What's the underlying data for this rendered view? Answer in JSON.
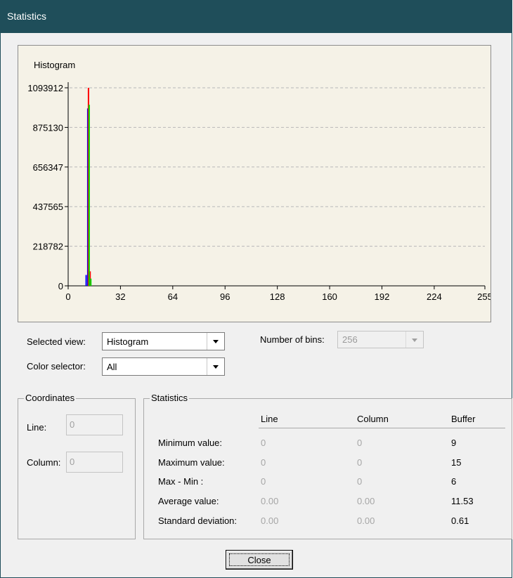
{
  "window": {
    "title": "Statistics"
  },
  "chart_data": {
    "type": "bar",
    "title": "Histogram",
    "yticks": [
      "1093912",
      "875130",
      "656347",
      "437565",
      "218782",
      "0"
    ],
    "ytick_values": [
      1093912,
      875130,
      656347,
      437565,
      218782,
      0
    ],
    "xticks": [
      "0",
      "32",
      "64",
      "96",
      "128",
      "160",
      "192",
      "224",
      "255"
    ],
    "xtick_values": [
      0,
      32,
      64,
      96,
      128,
      160,
      192,
      224,
      255
    ],
    "xlim": [
      0,
      255
    ],
    "ylim": [
      0,
      1093912
    ],
    "grid": true,
    "series": [
      {
        "color": "#0000ff",
        "x": [
          11,
          12
        ],
        "values": [
          60000,
          980000
        ]
      },
      {
        "color": "#ff0000",
        "x": [
          12,
          13
        ],
        "values": [
          1093912,
          80000
        ]
      },
      {
        "color": "#00dd00",
        "x": [
          12,
          13
        ],
        "values": [
          1000000,
          40000
        ]
      }
    ]
  },
  "controls": {
    "selected_view_label": "Selected view:",
    "selected_view_value": "Histogram",
    "color_selector_label": "Color selector:",
    "color_selector_value": "All",
    "bins_label": "Number of bins:",
    "bins_value": "256"
  },
  "coordinates": {
    "title": "Coordinates",
    "line_label": "Line:",
    "line_value": "0",
    "column_label": "Column:",
    "column_value": "0"
  },
  "statistics": {
    "title": "Statistics",
    "headers": [
      "Line",
      "Column",
      "Buffer"
    ],
    "rows": [
      {
        "label": "Minimum value:",
        "line": "0",
        "column": "0",
        "buffer": "9"
      },
      {
        "label": "Maximum value:",
        "line": "0",
        "column": "0",
        "buffer": "15"
      },
      {
        "label": "Max - Min :",
        "line": "0",
        "column": "0",
        "buffer": "6"
      },
      {
        "label": "Average value:",
        "line": "0.00",
        "column": "0.00",
        "buffer": "11.53"
      },
      {
        "label": "Standard deviation:",
        "line": "0.00",
        "column": "0.00",
        "buffer": "0.61"
      }
    ]
  },
  "buttons": {
    "close": "Close"
  },
  "icons": {
    "dropdown": "chevron-down-icon"
  }
}
